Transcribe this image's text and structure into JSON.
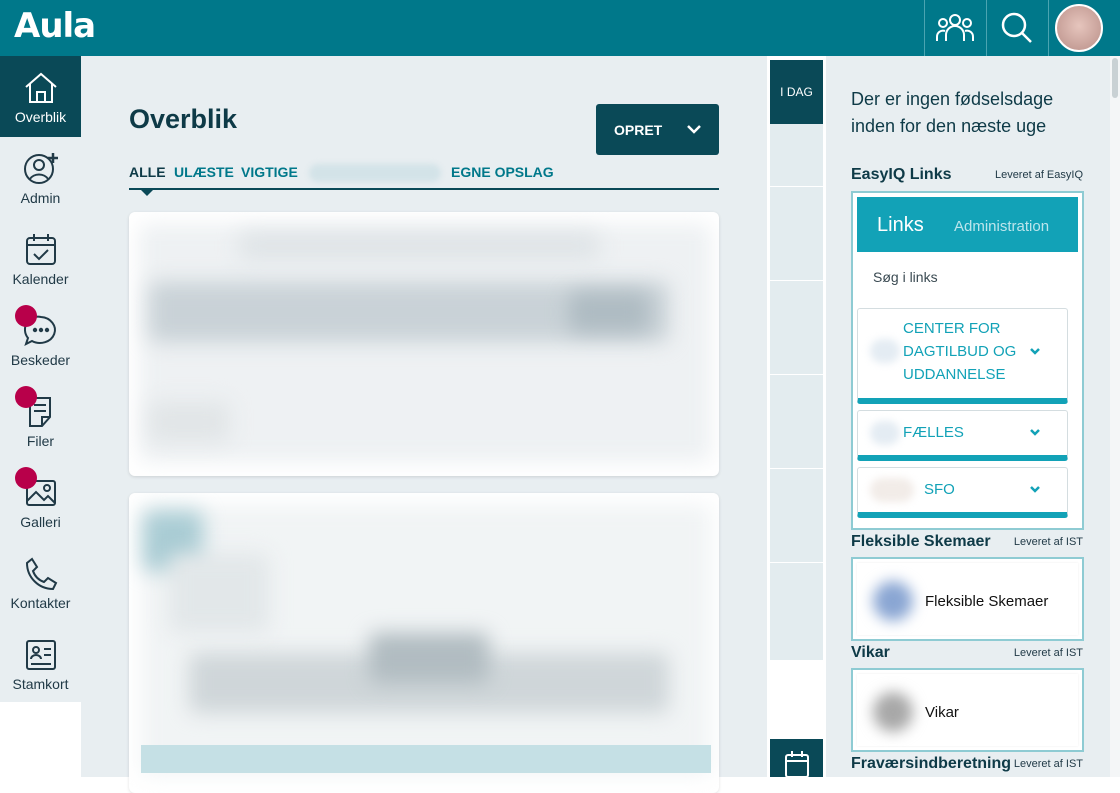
{
  "app": {
    "logo": "Aula"
  },
  "header": {
    "buttons": [
      {
        "name": "groups-icon"
      },
      {
        "name": "search-icon"
      },
      {
        "name": "profile-avatar"
      }
    ]
  },
  "sidebar": {
    "items": [
      {
        "label": "Overblik",
        "icon": "home-icon",
        "active": true
      },
      {
        "label": "Admin",
        "icon": "add-user-icon"
      },
      {
        "label": "Kalender",
        "icon": "calendar-icon"
      },
      {
        "label": "Beskeder",
        "icon": "chat-icon",
        "badge": true
      },
      {
        "label": "Filer",
        "icon": "document-icon",
        "badge": true
      },
      {
        "label": "Galleri",
        "icon": "gallery-icon",
        "badge": true
      },
      {
        "label": "Kontakter",
        "icon": "phone-icon"
      },
      {
        "label": "Stamkort",
        "icon": "contact-card-icon"
      }
    ]
  },
  "main": {
    "title": "Overblik",
    "create_button": "OPRET",
    "tabs": [
      {
        "label": "ALLE",
        "active": true
      },
      {
        "label": "ULÆSTE"
      },
      {
        "label": "VIGTIGE"
      },
      {
        "label": "EGNE OPSLAG"
      }
    ]
  },
  "calendar_strip": {
    "today_label": "I DAG"
  },
  "right_panel": {
    "birthday_text": "Der er ingen fødselsdage inden for den næste uge",
    "easyiq": {
      "title": "EasyIQ Links",
      "provider": "Leveret af EasyIQ",
      "tab_links": "Links",
      "tab_admin": "Administration",
      "search_placeholder": "Søg i links",
      "groups": [
        {
          "label": "CENTER FOR DAGTILBUD OG UDDANNELSE"
        },
        {
          "label": "FÆLLES"
        },
        {
          "label": "SFO"
        }
      ]
    },
    "fleksible": {
      "title": "Fleksible Skemaer",
      "provider": "Leveret af IST",
      "label": "Fleksible Skemaer"
    },
    "vikar": {
      "title": "Vikar",
      "provider": "Leveret af IST",
      "label": "Vikar"
    },
    "fravaer": {
      "title": "Fraværsindberetning",
      "provider": "Leveret af IST"
    }
  },
  "colors": {
    "brand": "#00788a",
    "dark": "#0a4957",
    "accent": "#12a2b7",
    "badge": "#b8004a",
    "background": "#e8eef1"
  }
}
